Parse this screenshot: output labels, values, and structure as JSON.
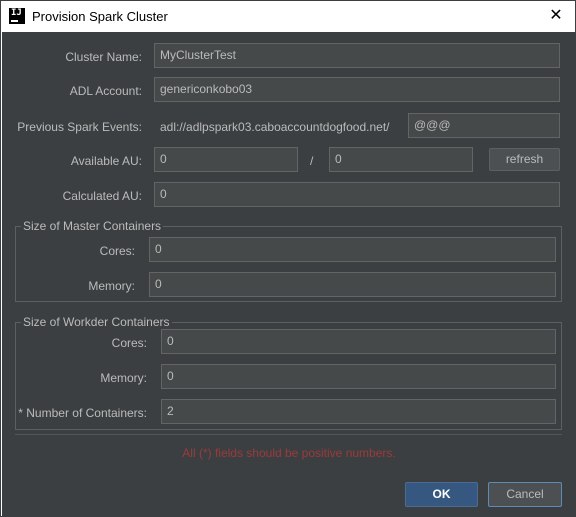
{
  "window": {
    "title": "Provision Spark Cluster",
    "icon": "intellij-icon",
    "icon_text": "IJ"
  },
  "form": {
    "cluster_name": {
      "label": "Cluster Name:",
      "value": "MyClusterTest"
    },
    "adl_account": {
      "label": "ADL Account:",
      "value": "genericonkobo03"
    },
    "previous_events": {
      "label": "Previous Spark Events:",
      "path_prefix": "adl://adlpspark03.caboaccountdogfood.net/",
      "value": "@@@"
    },
    "available_au": {
      "label": "Available AU:",
      "value_used": "0",
      "separator": "/",
      "value_total": "0",
      "refresh_label": "refresh"
    },
    "calculated_au": {
      "label": "Calculated AU:",
      "value": "0"
    }
  },
  "master": {
    "title": "Size of Master Containers",
    "cores": {
      "label": "Cores:",
      "value": "0"
    },
    "memory": {
      "label": "Memory:",
      "value": "0"
    }
  },
  "worker": {
    "title": "Size of Workder Containers",
    "cores": {
      "label": "Cores:",
      "value": "0"
    },
    "memory": {
      "label": "Memory:",
      "value": "0"
    },
    "count": {
      "label": "* Number of Containers:",
      "value": "2"
    }
  },
  "error_message": "All (*) fields should be positive numbers.",
  "buttons": {
    "ok": "OK",
    "cancel": "Cancel"
  },
  "colors": {
    "background": "#3c3f41",
    "field_bg": "#45494a",
    "error": "#9a3b3b",
    "ok_accent": "#365880"
  }
}
